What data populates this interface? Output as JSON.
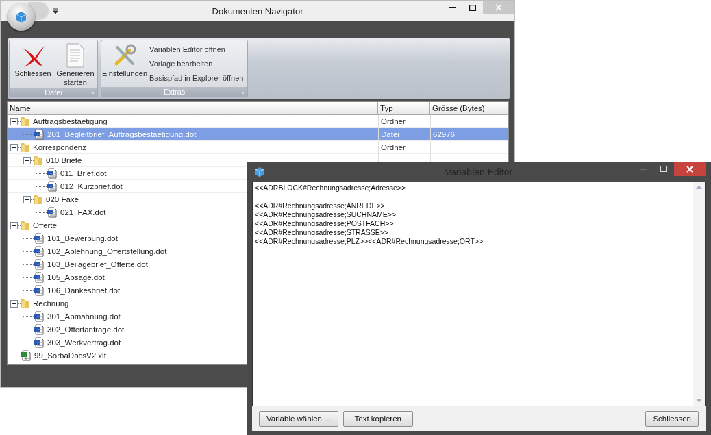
{
  "window": {
    "title": "Dokumenten Navigator"
  },
  "ribbon": {
    "groups": [
      {
        "label": "Datei",
        "buttons": [
          {
            "label": "Schliessen",
            "kind": "close"
          },
          {
            "label": "Generieren starten",
            "kind": "document"
          }
        ]
      },
      {
        "label": "Extras",
        "buttons": [
          {
            "label": "Einstellungen",
            "kind": "tools"
          }
        ],
        "items": [
          "Variablen Editor öffnen",
          "Vorlage bearbeiten",
          "Basispfad in Explorer öffnen"
        ]
      }
    ]
  },
  "tree": {
    "columns": [
      "Name",
      "Typ",
      "Grösse (Bytes)"
    ],
    "rows": [
      {
        "name": "Auftragsbestaetigung",
        "kind": "folder",
        "type": "Ordner",
        "expanded": true,
        "selected": false,
        "children": [
          {
            "name": "201_Begleitbrief_Auftragsbestaetigung.dot",
            "kind": "doc",
            "type": "Datei",
            "size": "62976",
            "selected": true
          }
        ]
      },
      {
        "name": "Korrespondenz",
        "kind": "folder",
        "type": "Ordner",
        "expanded": true,
        "selected": false,
        "children": [
          {
            "name": "010 Briefe",
            "kind": "folder",
            "expanded": true,
            "selected": false,
            "children": [
              {
                "name": "011_Brief.dot",
                "kind": "doc",
                "selected": false
              },
              {
                "name": "012_Kurzbrief.dot",
                "kind": "doc",
                "selected": false
              }
            ]
          },
          {
            "name": "020 Faxe",
            "kind": "folder",
            "expanded": true,
            "selected": false,
            "children": [
              {
                "name": "021_FAX.dot",
                "kind": "doc",
                "selected": false
              }
            ]
          }
        ]
      },
      {
        "name": "Offerte",
        "kind": "folder",
        "expanded": true,
        "selected": false,
        "children": [
          {
            "name": "101_Bewerbung.dot",
            "kind": "doc",
            "selected": false
          },
          {
            "name": "102_Ablehnung_Offertstellung.dot",
            "kind": "doc",
            "selected": false
          },
          {
            "name": "103_Beilagebrief_Offerte.dot",
            "kind": "doc",
            "selected": false
          },
          {
            "name": "105_Absage.dot",
            "kind": "doc",
            "selected": false
          },
          {
            "name": "106_Dankesbrief.dot",
            "kind": "doc",
            "selected": false
          }
        ]
      },
      {
        "name": "Rechnung",
        "kind": "folder",
        "expanded": true,
        "selected": false,
        "children": [
          {
            "name": "301_Abmahnung.dot",
            "kind": "doc",
            "selected": false
          },
          {
            "name": "302_Offertanfrage.dot",
            "kind": "doc",
            "selected": false
          },
          {
            "name": "303_Werkvertrag.dot",
            "kind": "doc",
            "selected": false
          }
        ]
      },
      {
        "name": "99_SorbaDocsV2.xlt",
        "kind": "sheet",
        "selected": false
      }
    ]
  },
  "editor": {
    "title": "Variablen Editor",
    "blocks": [
      [
        "<<ADRBLOCK#Rechnungsadresse;Adresse>>"
      ],
      [
        "<<ADR#Rechnungsadresse;ANREDE>>",
        "<<ADR#Rechnungsadresse;SUCHNAME>>",
        "<<ADR#Rechnungsadresse;POSTFACH>>",
        "<<ADR#Rechnungsadresse;STRASSE>>",
        "<<ADR#Rechnungsadresse;PLZ>><<ADR#Rechnungsadresse;ORT>>"
      ]
    ],
    "buttons": [
      "Variable wählen ...",
      "Text kopieren"
    ],
    "close_button": "Schliessen"
  }
}
